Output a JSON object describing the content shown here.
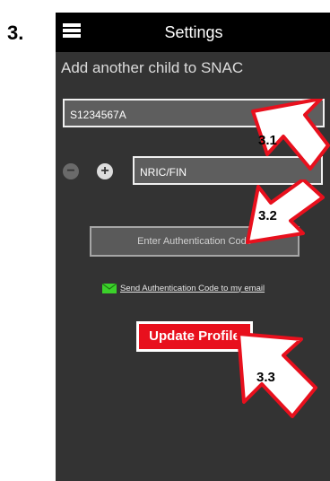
{
  "step": {
    "number": "3."
  },
  "header": {
    "title": "Settings",
    "menu_icon": "hamburger-menu-icon"
  },
  "form": {
    "section_title": "Add another child to SNAC",
    "child_id_value": "S1234567A",
    "nric_placeholder": "NRIC/FIN",
    "auth_code_button": "Enter Authentication Code",
    "email_link": "Send Authentication Code to my email",
    "update_button": "Update Profile"
  },
  "callouts": [
    {
      "label": "3.1"
    },
    {
      "label": "3.2"
    },
    {
      "label": "3.3"
    }
  ],
  "colors": {
    "update_button": "#e8101d",
    "callout_fill": "#ffffff",
    "callout_stroke": "#e8101d",
    "mail_icon": "#3bd12a"
  }
}
